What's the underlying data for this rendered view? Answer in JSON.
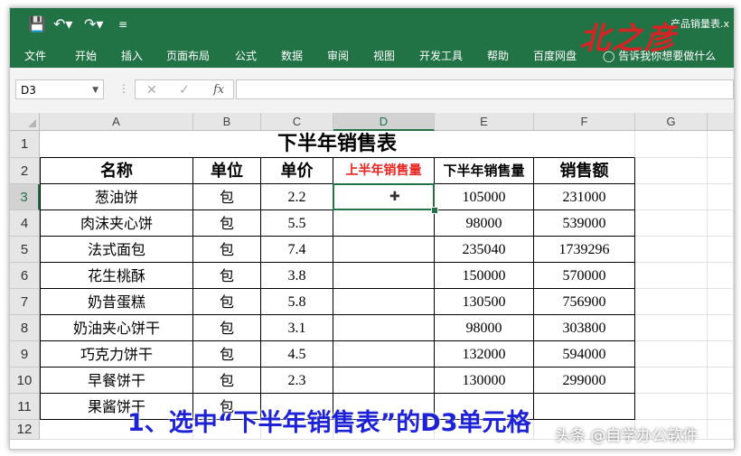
{
  "window": {
    "title": "产品销量表.x",
    "logo_text": "北之彦"
  },
  "qat": {
    "save_icon": "save-icon",
    "undo_icon": "undo-icon",
    "redo_icon": "redo-icon",
    "customize_icon": "customize-icon"
  },
  "ribbon": {
    "tabs": [
      "文件",
      "开始",
      "插入",
      "页面布局",
      "公式",
      "数据",
      "审阅",
      "视图",
      "开发工具",
      "帮助",
      "百度网盘"
    ],
    "tell_me": "告诉我你想要做什么"
  },
  "formula_bar": {
    "name_box": "D3",
    "fx_label": "fx",
    "formula": ""
  },
  "columns": [
    "A",
    "B",
    "C",
    "D",
    "E",
    "F",
    "G"
  ],
  "selected_column": "D",
  "row_numbers": [
    "1",
    "2",
    "3",
    "4",
    "5",
    "6",
    "7",
    "8",
    "9",
    "10",
    "11",
    "12"
  ],
  "selected_row": "3",
  "sheet": {
    "title": "下半年销售表",
    "headers": [
      "名称",
      "单位",
      "单价",
      "上半年销售量",
      "下半年销售量",
      "销售额"
    ],
    "rows": [
      [
        "葱油饼",
        "包",
        "2.2",
        "",
        "105000",
        "231000"
      ],
      [
        "肉沫夹心饼",
        "包",
        "5.5",
        "",
        "98000",
        "539000"
      ],
      [
        "法式面包",
        "包",
        "7.4",
        "",
        "235040",
        "1739296"
      ],
      [
        "花生桃酥",
        "包",
        "3.8",
        "",
        "150000",
        "570000"
      ],
      [
        "奶昔蛋糕",
        "包",
        "5.8",
        "",
        "130500",
        "756900"
      ],
      [
        "奶油夹心饼干",
        "包",
        "3.1",
        "",
        "98000",
        "303800"
      ],
      [
        "巧克力饼干",
        "包",
        "4.5",
        "",
        "132000",
        "594000"
      ],
      [
        "早餐饼干",
        "包",
        "2.3",
        "",
        "130000",
        "299000"
      ],
      [
        "果酱饼干",
        "包",
        "",
        "",
        "",
        ""
      ]
    ]
  },
  "colors": {
    "ribbon": "#217346",
    "accent_header": "#e8231f",
    "caption": "#1e22d6"
  },
  "caption": "1、选中“下半年销售表”的D3单元格",
  "watermark": "头条 @自学办公软件"
}
